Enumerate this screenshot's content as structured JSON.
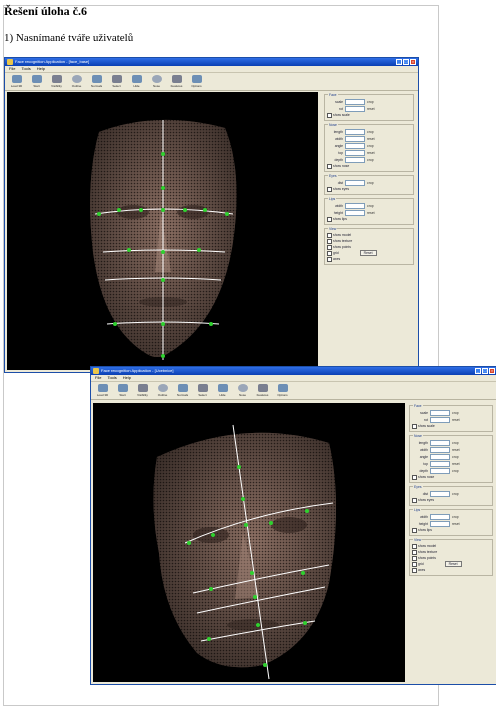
{
  "document": {
    "heading": "Řešení úloha č.6",
    "paragraph": "1) Nasnímané tváře uživatelů"
  },
  "screenshots": [
    {
      "title": "Face recognition  Application - [face_base]",
      "menu": [
        "File",
        "Tools",
        "Help"
      ],
      "toolbar": [
        "Load 3D",
        "Start",
        "Visibility",
        "Outline",
        "Normals",
        "Select",
        "Hide",
        "Nose",
        "Features",
        "Options"
      ],
      "panel": {
        "groups": [
          {
            "title": "Face",
            "rows": [
              {
                "label": "scale",
                "right": "crop"
              },
              {
                "label": "rot",
                "right": "reset"
              }
            ],
            "checks": [
              "show scale"
            ]
          },
          {
            "title": "Nose",
            "rows": [
              {
                "label": "length",
                "right": "crop"
              },
              {
                "label": "width",
                "right": "reset"
              },
              {
                "label": "angle",
                "right": "crop"
              },
              {
                "label": "top",
                "right": "reset"
              },
              {
                "label": "depth",
                "right": "crop"
              }
            ],
            "checks": [
              "show nose"
            ]
          },
          {
            "title": "Eyes",
            "rows": [
              {
                "label": "dist",
                "right": "crop"
              }
            ],
            "checks": [
              "show eyes"
            ]
          },
          {
            "title": "Lips",
            "rows": [
              {
                "label": "width",
                "right": "crop"
              },
              {
                "label": "height",
                "right": "reset"
              }
            ],
            "checks": [
              "show lips"
            ]
          },
          {
            "title": "View",
            "rows": [],
            "checks": [
              "show model",
              "show texture",
              "show points",
              "grid",
              "axes"
            ],
            "button": "Reset"
          }
        ]
      }
    },
    {
      "title": "Face recognition  Application - [Ucebnice]",
      "menu": [
        "File",
        "Tools",
        "Help"
      ],
      "toolbar": [
        "Load 3D",
        "Start",
        "Visibility",
        "Outline",
        "Normals",
        "Select",
        "Hide",
        "Nose",
        "Features",
        "Options"
      ],
      "panel": {
        "groups": [
          {
            "title": "Face",
            "rows": [
              {
                "label": "scale",
                "right": "crop"
              },
              {
                "label": "rot",
                "right": "reset"
              }
            ],
            "checks": [
              "show scale"
            ]
          },
          {
            "title": "Nose",
            "rows": [
              {
                "label": "length",
                "right": "crop"
              },
              {
                "label": "width",
                "right": "reset"
              },
              {
                "label": "angle",
                "right": "crop"
              },
              {
                "label": "top",
                "right": "reset"
              },
              {
                "label": "depth",
                "right": "crop"
              }
            ],
            "checks": [
              "show nose"
            ]
          },
          {
            "title": "Eyes",
            "rows": [
              {
                "label": "dist",
                "right": "crop"
              }
            ],
            "checks": [
              "show eyes"
            ]
          },
          {
            "title": "Lips",
            "rows": [
              {
                "label": "width",
                "right": "crop"
              },
              {
                "label": "height",
                "right": "reset"
              }
            ],
            "checks": [
              "show lips"
            ]
          },
          {
            "title": "View",
            "rows": [],
            "checks": [
              "show model",
              "show texture",
              "show points",
              "grid",
              "axes"
            ],
            "button": "Reset"
          }
        ]
      }
    }
  ],
  "colors": {
    "face_mesh": "#8a6e62",
    "face_mesh_dark": "#5e4a42",
    "measure_line": "#ffffff",
    "landmark": "#2fd12f",
    "viewport_bg": "#000000",
    "window_bg": "#ece9d8",
    "titlebar": "#0a3fb3"
  }
}
